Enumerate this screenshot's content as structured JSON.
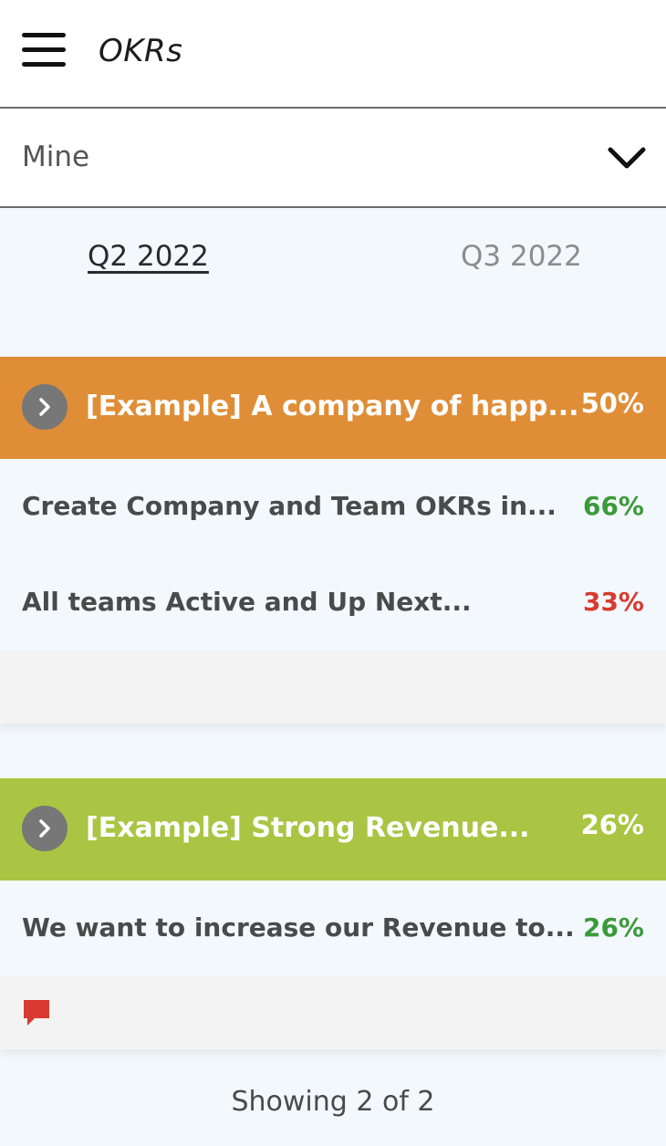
{
  "header": {
    "title": "OKRs",
    "menu_icon": "hamburger-menu-icon"
  },
  "filter": {
    "selected": "Mine",
    "icon": "chevron-down-icon"
  },
  "tabs": [
    {
      "label": "Q2 2022",
      "active": true
    },
    {
      "label": "Q3 2022",
      "active": false
    }
  ],
  "objectives": [
    {
      "title": "[Example] A company of happ...",
      "progress": "50%",
      "color": "#df8e37",
      "key_results": [
        {
          "title": "Create Company and Team OKRs in...",
          "progress": "66%",
          "color": "#3a9a3a"
        },
        {
          "title": "All teams Active and Up Next...",
          "progress": "33%",
          "color": "#d93a2f"
        }
      ]
    },
    {
      "title": "[Example] Strong Revenue...",
      "progress": "26%",
      "color": "#a9c543",
      "key_results": [
        {
          "title": "We want to increase our Revenue to...",
          "progress": "26%",
          "color": "#3a9a3a"
        }
      ],
      "comment_icon": "comment-icon"
    }
  ],
  "footer": {
    "showing": "Showing 2 of 2"
  }
}
